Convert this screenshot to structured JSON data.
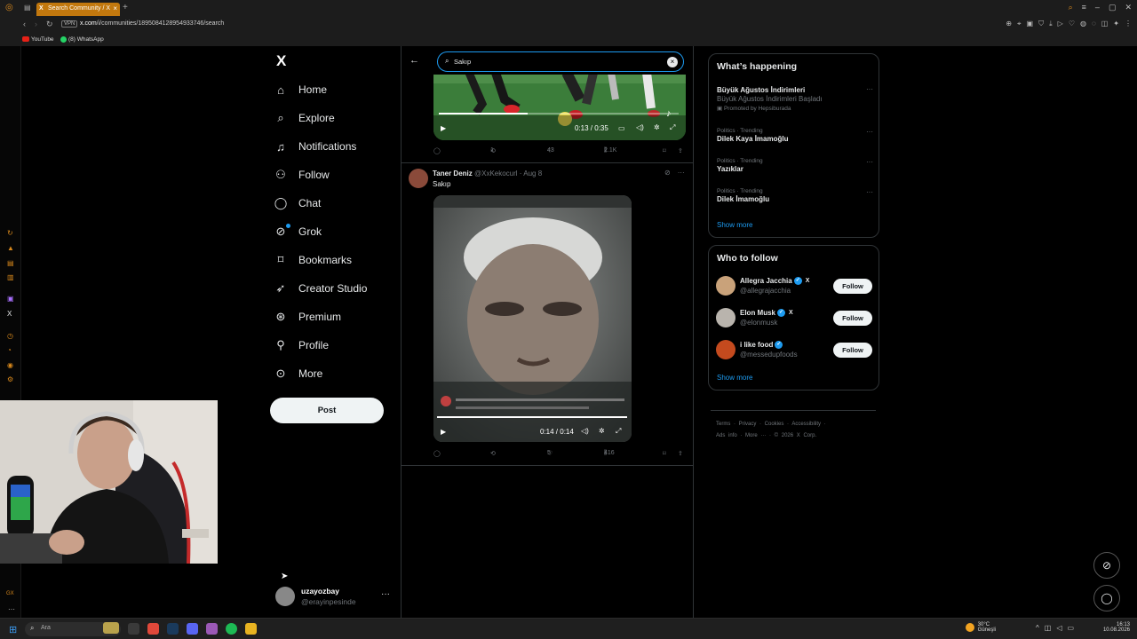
{
  "browser": {
    "tab_title": "Search Community / X",
    "url_domain": "x.com",
    "url_path": "/i/communities/1895084128954933746/search",
    "vpn_label": "VPN",
    "bookmarks": [
      "YouTube",
      "(8) WhatsApp"
    ]
  },
  "sidebar": {
    "logo": "X",
    "items": [
      {
        "label": "Home",
        "icon": "home-icon"
      },
      {
        "label": "Explore",
        "icon": "search-icon"
      },
      {
        "label": "Notifications",
        "icon": "bell-icon"
      },
      {
        "label": "Follow",
        "icon": "person-plus-icon"
      },
      {
        "label": "Chat",
        "icon": "chat-icon"
      },
      {
        "label": "Grok",
        "icon": "grok-icon"
      },
      {
        "label": "Bookmarks",
        "icon": "bookmark-icon"
      },
      {
        "label": "Creator Studio",
        "icon": "rocket-icon"
      },
      {
        "label": "Premium",
        "icon": "premium-icon"
      },
      {
        "label": "Profile",
        "icon": "person-icon"
      },
      {
        "label": "More",
        "icon": "more-circle-icon"
      }
    ],
    "post_button": "Post",
    "account": {
      "name": "uzayozbay",
      "handle": "@erayinpesinde"
    }
  },
  "main": {
    "search_value": "Sakıp",
    "first_post": {
      "video_time": "0:13 / 0:35",
      "progress": 0.37,
      "replies": "",
      "reposts": "1",
      "likes": "43",
      "views": "2.1K"
    },
    "second_post": {
      "author": "Taner Deniz",
      "handle": "@XxKekocurl",
      "date": "Aug 8",
      "text": "Sakıp",
      "video_time": "0:14 / 0:14",
      "progress": 1.0,
      "replies": "",
      "reposts": "",
      "likes": "5",
      "views": "416"
    }
  },
  "right": {
    "happening_title": "What’s happening",
    "trends": [
      {
        "category": "",
        "title": "Büyük Ağustos İndirimleri",
        "subtitle": "Büyük Ağustos İndirimleri Başladı",
        "promo": "Promoted by Hepsiburada"
      },
      {
        "category": "Politics · Trending",
        "title": "Dilek Kaya İmamoğlu",
        "subtitle": "",
        "promo": ""
      },
      {
        "category": "Politics · Trending",
        "title": "Yazıklar",
        "subtitle": "",
        "promo": ""
      },
      {
        "category": "Politics · Trending",
        "title": "Dilek İmamoğlu",
        "subtitle": "",
        "promo": ""
      }
    ],
    "show_more": "Show more",
    "wtf_title": "Who to follow",
    "follow_suggestions": [
      {
        "name": "Allegra Jacchia",
        "handle": "@allegrajacchia",
        "button": "Follow",
        "avatar_color": "#c9a27a"
      },
      {
        "name": "Elon Musk",
        "handle": "@elonmusk",
        "button": "Follow",
        "avatar_color": "#b9b4ad"
      },
      {
        "name": "i like food",
        "handle": "@messedupfoods",
        "button": "Follow",
        "avatar_color": "#c44a1e"
      }
    ],
    "footer_line1": "Terms · Privacy · Cookies · Accessibility ·",
    "footer_line2": "Ads info · More ··· · © 2026 X Corp."
  },
  "taskbar": {
    "search_placeholder": "Ara",
    "weather_temp": "30°C",
    "weather_desc": "Güneşli",
    "time": "16:13",
    "date": "10.08.2026"
  },
  "colors": {
    "accent": "#1d9bf0",
    "tab": "#c2780e",
    "background": "#000000"
  }
}
